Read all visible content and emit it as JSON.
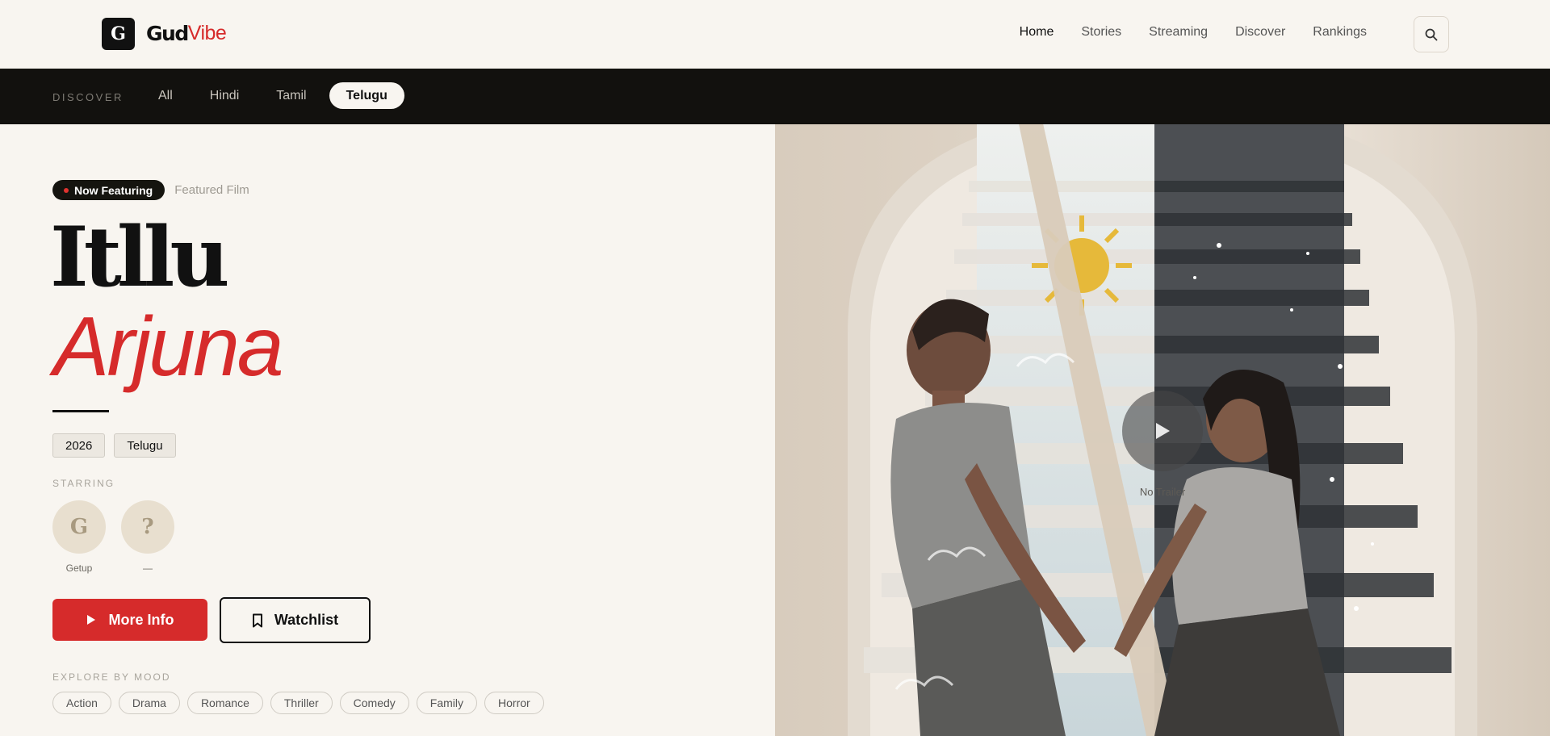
{
  "header": {
    "logo_letter": "G",
    "brand_part1": "Gud",
    "brand_part2": "Vibe",
    "nav": [
      {
        "label": "Home",
        "active": true
      },
      {
        "label": "Stories",
        "active": false
      },
      {
        "label": "Streaming",
        "active": false
      },
      {
        "label": "Discover",
        "active": false
      },
      {
        "label": "Rankings",
        "active": false
      }
    ],
    "search_icon": "search-icon"
  },
  "discover": {
    "label": "DISCOVER",
    "tabs": [
      {
        "label": "All",
        "active": false
      },
      {
        "label": "Hindi",
        "active": false
      },
      {
        "label": "Tamil",
        "active": false
      },
      {
        "label": "Telugu",
        "active": true
      }
    ]
  },
  "hero": {
    "badge": "Now Featuring",
    "subtitle": "Featured Film",
    "title_line1": "Itllu",
    "title_line2": "Arjuna",
    "tags": [
      "2026",
      "Telugu"
    ],
    "starring_label": "STARRING",
    "cast": [
      {
        "initial": "G",
        "name": "Getup"
      },
      {
        "initial": "?",
        "name": "—"
      }
    ],
    "more_info_label": "More Info",
    "watchlist_label": "Watchlist",
    "mood_label": "EXPLORE BY MOOD",
    "moods": [
      "Action",
      "Drama",
      "Romance",
      "Thriller",
      "Comedy",
      "Family",
      "Horror"
    ]
  },
  "poster": {
    "no_trailer": "No Trailer"
  },
  "colors": {
    "accent_red": "#d62b2b",
    "dark_bar": "#12110e",
    "page_bg": "#f8f5f0"
  }
}
